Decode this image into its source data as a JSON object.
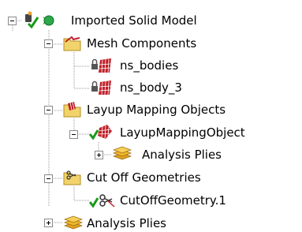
{
  "tree": {
    "nodes": [
      {
        "id": "root",
        "label": "Imported Solid Model",
        "icon": "solid-model-check-icon"
      },
      {
        "id": "mesh",
        "label": "Mesh Components",
        "icon": "folder-icon"
      },
      {
        "id": "ns_bodies",
        "label": "ns_bodies",
        "icon": "locked-mesh-icon"
      },
      {
        "id": "ns_body_3",
        "label": "ns_body_3",
        "icon": "locked-mesh-icon"
      },
      {
        "id": "layup",
        "label": "Layup Mapping Objects",
        "icon": "folder-icon"
      },
      {
        "id": "lmo",
        "label": "LayupMappingObject",
        "icon": "layup-mapping-check-icon"
      },
      {
        "id": "plies1",
        "label": "Analysis Plies",
        "icon": "plies-stack-icon"
      },
      {
        "id": "cutoff",
        "label": "Cut Off Geometries",
        "icon": "folder-icon"
      },
      {
        "id": "cog",
        "label": "CutOffGeometry.1",
        "icon": "scissors-check-icon"
      },
      {
        "id": "plies2",
        "label": "Analysis Plies",
        "icon": "plies-stack-icon"
      }
    ]
  },
  "colors": {
    "check": "#1a9a1a",
    "folder": "#f2d36b",
    "mesh_red": "#c0202a",
    "lock": "#555555",
    "plies": "#f0b82a",
    "tree_line": "#9a9a9a"
  }
}
